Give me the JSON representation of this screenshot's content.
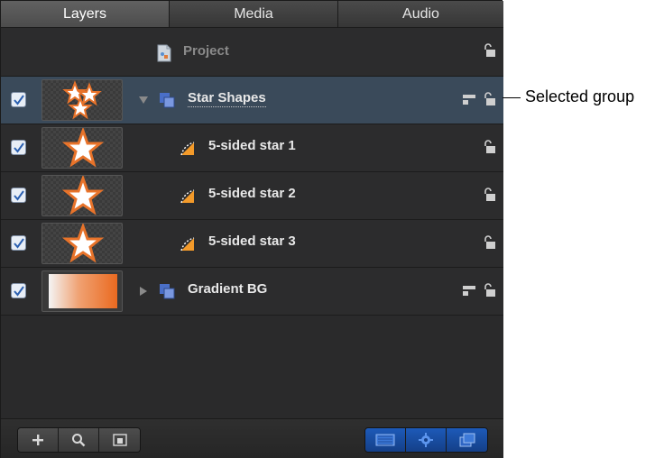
{
  "tabs": [
    {
      "label": "Layers",
      "active": true
    },
    {
      "label": "Media",
      "active": false
    },
    {
      "label": "Audio",
      "active": false
    }
  ],
  "project": {
    "label": "Project",
    "icon": "project-document-icon"
  },
  "layers": [
    {
      "label": "Star Shapes",
      "kind": "group",
      "expanded": true,
      "selected": true,
      "checked": true
    },
    {
      "label": "5-sided star 1",
      "kind": "shape",
      "checked": true
    },
    {
      "label": "5-sided star 2",
      "kind": "shape",
      "checked": true
    },
    {
      "label": "5-sided star 3",
      "kind": "shape",
      "checked": true
    },
    {
      "label": "Gradient BG",
      "kind": "group",
      "expanded": false,
      "checked": true
    }
  ],
  "toolbar": {
    "left": [
      "add-icon",
      "search-icon",
      "isolate-icon"
    ],
    "right": [
      "show-masks-icon",
      "show-behaviors-icon",
      "show-layers-icon"
    ]
  },
  "callout": {
    "label": "Selected group"
  },
  "colors": {
    "selected_row": "#3a4a5a",
    "panel_bg": "#2c2c2d",
    "accent_blue": "#1d5ab8",
    "star_fill": "#ffffff",
    "star_stroke": "#e8732a"
  }
}
